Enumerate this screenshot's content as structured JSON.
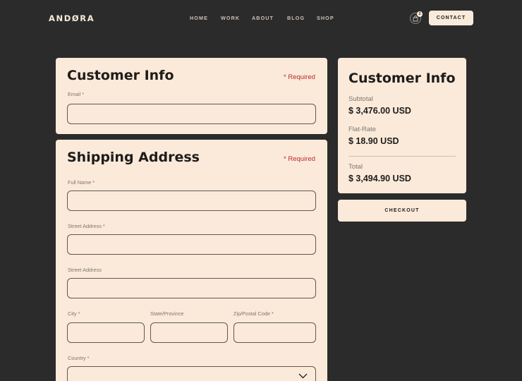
{
  "brand": {
    "logo": "ANDØRA"
  },
  "nav": {
    "links": [
      "HOME",
      "WORK",
      "ABOUT",
      "BLOG",
      "SHOP"
    ],
    "cart_count": "2",
    "contact_label": "CONTACT"
  },
  "customer_info": {
    "title": "Customer Info",
    "required_note": "* Required",
    "email_label": "Email *"
  },
  "shipping": {
    "title": "Shipping Address",
    "required_note": "* Required",
    "full_name_label": "Full Name *",
    "street_label": "Street Address *",
    "street2_label": "Street Address",
    "city_label": "City *",
    "state_label": "State/Province",
    "zip_label": "Zip/Postal Code *",
    "country_label": "Country *"
  },
  "summary": {
    "title": "Customer Info",
    "subtotal_label": "Subtotal",
    "subtotal_value": "$ 3,476.00 USD",
    "shipping_label": "Flat-Rate",
    "shipping_value": "$ 18.90 USD",
    "total_label": "Total",
    "total_value": "$ 3,494.90 USD",
    "checkout_label": "CHECKOUT"
  },
  "icons": {
    "cart": "shopping-bag-icon",
    "select_arrow": "chevron-down-icon"
  },
  "colors": {
    "background": "#2c2b2b",
    "card": "#fbead9",
    "required": "#c0282c"
  }
}
